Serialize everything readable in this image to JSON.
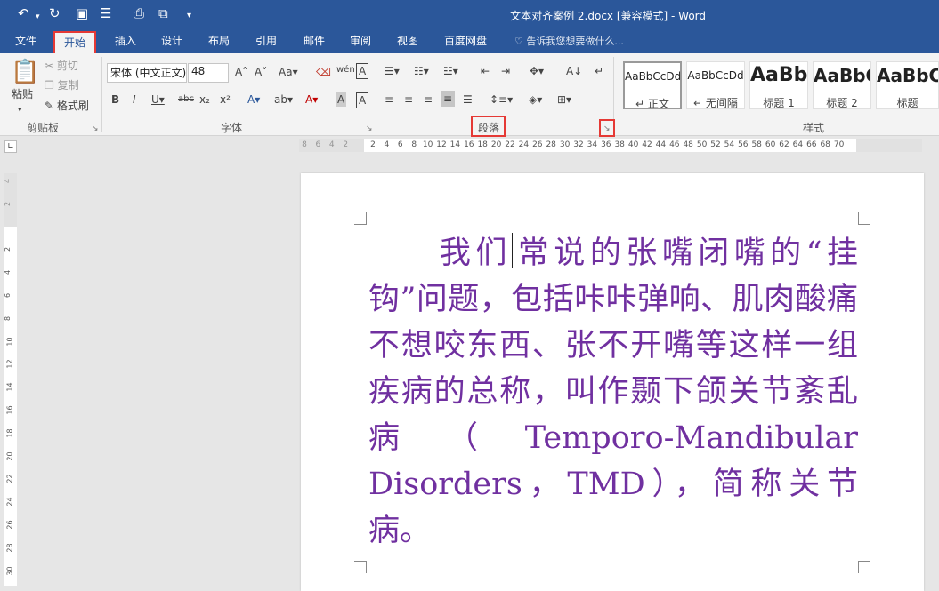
{
  "window": {
    "title": "文本对齐案例 2.docx [兼容模式] - Word"
  },
  "quick_access": [
    "undo-icon",
    "redo-icon",
    "save-icon",
    "touch-mode-icon",
    "print-preview-icon",
    "screenshot-icon",
    "customize-icon"
  ],
  "tabs": [
    "文件",
    "开始",
    "插入",
    "设计",
    "布局",
    "引用",
    "邮件",
    "审阅",
    "视图",
    "百度网盘"
  ],
  "active_tab": "开始",
  "tell_me": "告诉我您想要做什么...",
  "clipboard": {
    "paste": "粘贴",
    "cut": "剪切",
    "copy": "复制",
    "format_painter": "格式刷",
    "group": "剪贴板"
  },
  "font": {
    "name": "宋体 (中文正文)",
    "size": "48",
    "group": "字体"
  },
  "paragraph": {
    "group": "段落"
  },
  "styles": {
    "group": "样式",
    "items": [
      {
        "sample": "AaBbCcDd",
        "name": "正文"
      },
      {
        "sample": "AaBbCcDd",
        "name": "无间隔"
      },
      {
        "sample": "AaBb",
        "name": "标题 1"
      },
      {
        "sample": "AaBbC",
        "name": "标题 2"
      },
      {
        "sample": "AaBbC",
        "name": "标题"
      }
    ]
  },
  "ruler": {
    "ticks": [
      "8",
      "6",
      "4",
      "2",
      "",
      "2",
      "4",
      "6",
      "8",
      "10",
      "12",
      "14",
      "16",
      "18",
      "20",
      "22",
      "24",
      "26",
      "28",
      "30",
      "32",
      "34",
      "36",
      "38",
      "40",
      "42",
      "44",
      "46",
      "48",
      "50",
      "52",
      "54",
      "56",
      "58",
      "60",
      "62",
      "64",
      "66",
      "68",
      "70"
    ],
    "vticks": [
      "4",
      "2",
      "",
      "2",
      "4",
      "6",
      "8",
      "10",
      "12",
      "14",
      "16",
      "18",
      "20",
      "22",
      "24",
      "26",
      "28",
      "30"
    ]
  },
  "document": {
    "before_cursor": "我们",
    "after_cursor": "常说的张嘴闭嘴的“挂钩”问题，包括咔咔弹响、肌肉酸痛不想咬东西、张不开嘴等这样一组疾病的总称，叫作颞下颌关节紊乱病（Temporo-Mandibular Disorders，TMD），简称关节病。"
  },
  "colors": {
    "brand": "#2b579a",
    "text": "#7030a0",
    "highlight": "#e53935"
  }
}
